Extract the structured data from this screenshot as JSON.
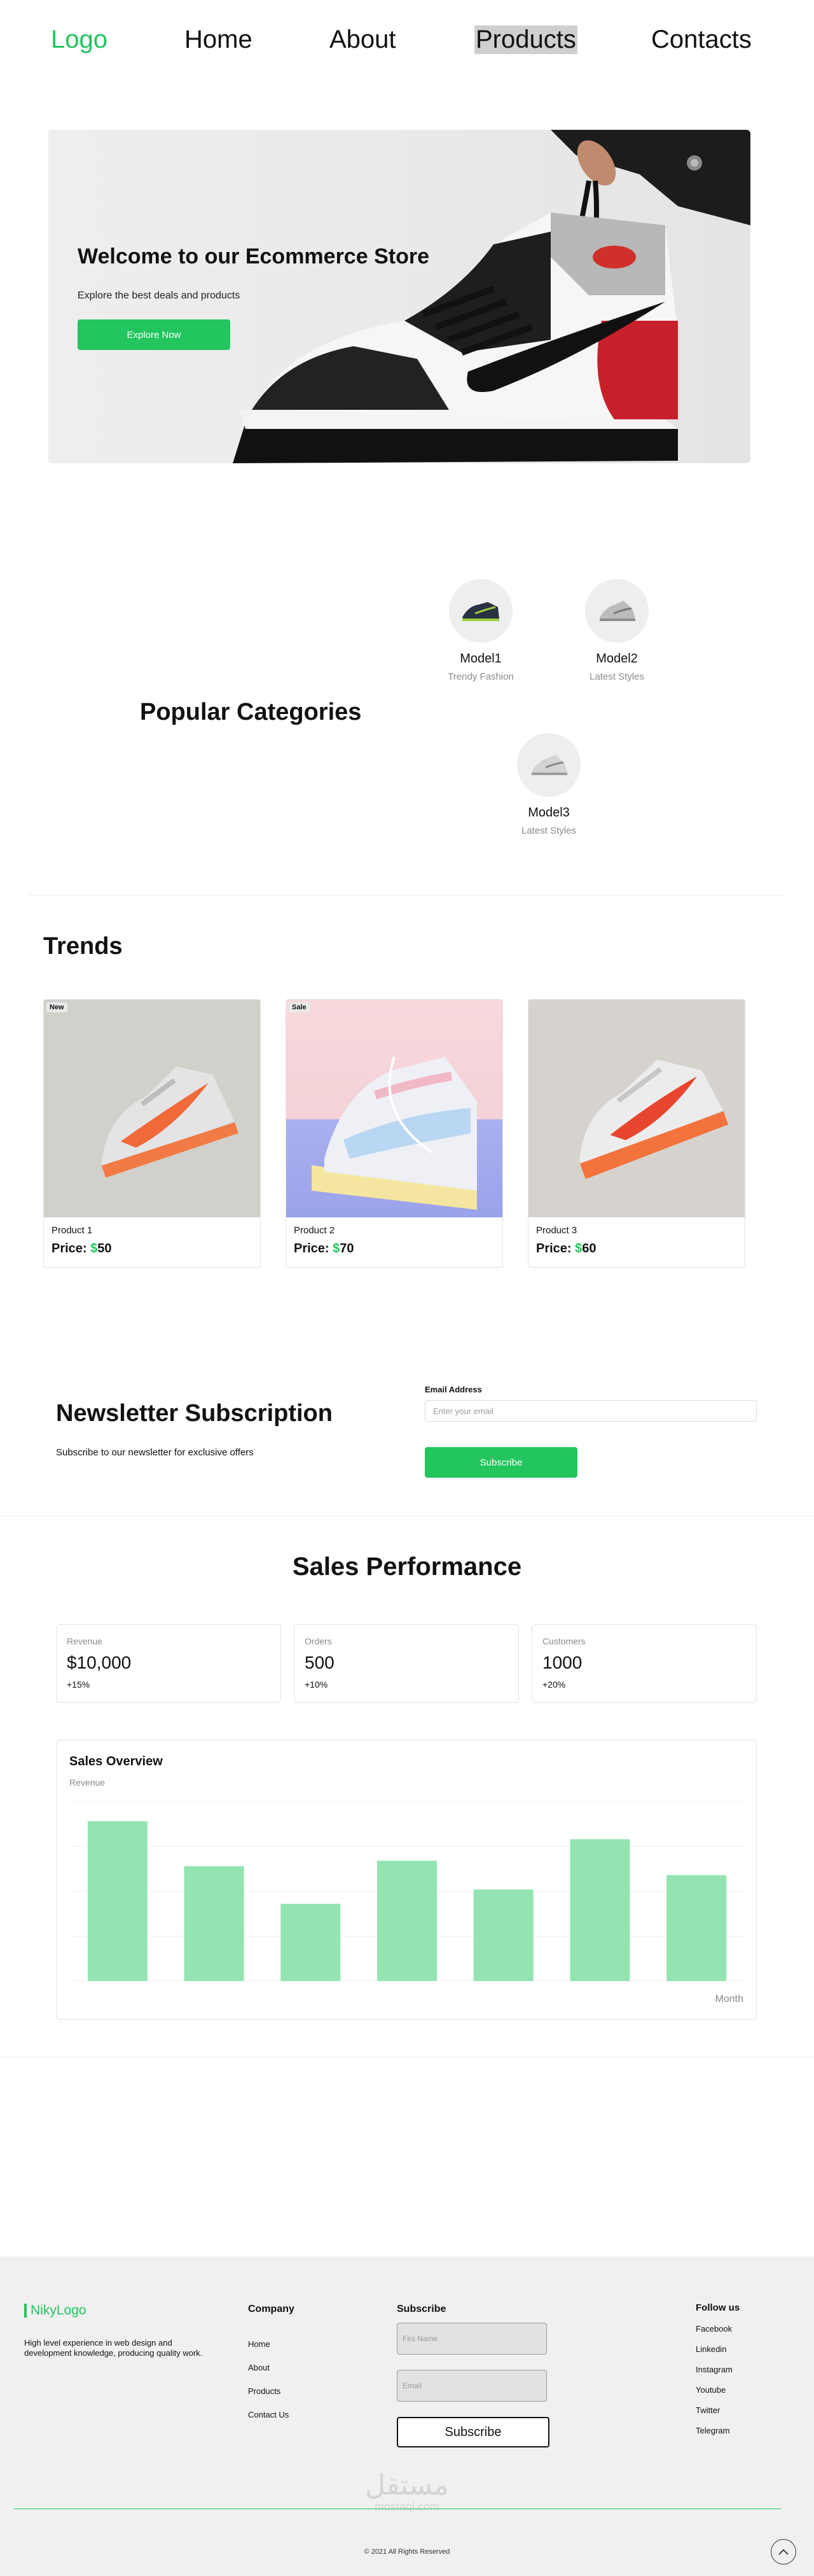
{
  "nav": {
    "logo": "Logo",
    "links": [
      "Home",
      "About",
      "Products",
      "Contacts"
    ],
    "active": "Products"
  },
  "hero": {
    "title": "Welcome to our Ecommerce Store",
    "subtitle": "Explore the best deals and products",
    "cta": "Explore Now"
  },
  "categories": {
    "title": "Popular Categories",
    "items": [
      {
        "name": "Model1",
        "sub": "Trendy Fashion"
      },
      {
        "name": "Model2",
        "sub": "Latest Styles"
      },
      {
        "name": "Model3",
        "sub": "Latest Styles"
      }
    ]
  },
  "trends": {
    "title": "Trends",
    "price_label": "Price:",
    "currency": "$",
    "products": [
      {
        "tag": "New",
        "name": "Product 1",
        "price": "50"
      },
      {
        "tag": "Sale",
        "name": "Product 2",
        "price": "70"
      },
      {
        "tag": "",
        "name": "Product 3",
        "price": "60"
      }
    ]
  },
  "newsletter": {
    "title": "Newsletter Subscription",
    "subtitle": "Subscribe to our newsletter for exclusive offers",
    "email_label": "Email Address",
    "email_placeholder": "Enter your email",
    "button": "Subscribe"
  },
  "sales": {
    "title": "Sales Performance",
    "stats": [
      {
        "label": "Revenue",
        "value": "$10,000",
        "change": "+15%"
      },
      {
        "label": "Orders",
        "value": "500",
        "change": "+10%"
      },
      {
        "label": "Customers",
        "value": "1000",
        "change": "+20%"
      }
    ]
  },
  "chart_data": {
    "type": "bar",
    "title": "Sales Overview",
    "ylabel": "Revenue",
    "xlabel": "Month",
    "grid": true,
    "legend": "none",
    "color": "#93e4b0",
    "values": [
      89,
      64,
      43,
      67,
      51,
      79,
      59
    ],
    "ylim": [
      0,
      100
    ]
  },
  "footer": {
    "brand": "NikyLogo",
    "description": "High level experience in web design and development knowledge, producing quality work.",
    "company_title": "Company",
    "company_links": [
      "Home",
      "About",
      "Products",
      "Contact Us"
    ],
    "subscribe_title": "Subscribe",
    "first_name_placeholder": "Firs Name",
    "email_placeholder": "Email",
    "subscribe_button": "Subscribe",
    "follow_title": "Follow us",
    "follow_links": [
      "Facebook",
      "Linkedin",
      "Instagram",
      "Youtube",
      "Twitter",
      "Telegram"
    ],
    "watermark_ar": "مستقل",
    "watermark_en": "mostaql.com",
    "copyright": "© 2021 All Rights Reserved"
  },
  "colors": {
    "accent": "#22c55e",
    "bar": "#93e4b0",
    "footer_bg": "#f0f0f0"
  }
}
